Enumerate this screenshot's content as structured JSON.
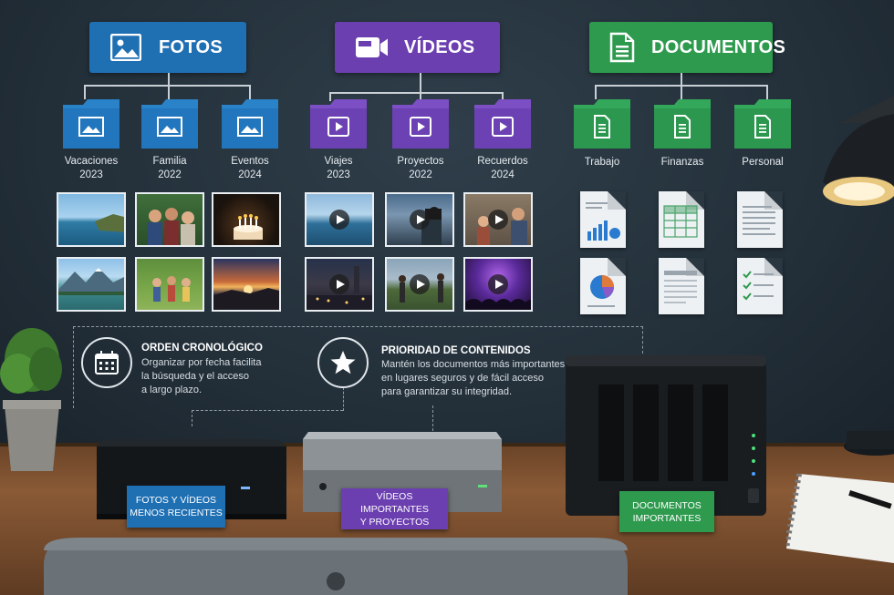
{
  "categories": {
    "fotos": {
      "label": "FOTOS",
      "color": "#1f6fb3",
      "icon": "image-icon"
    },
    "videos": {
      "label": "VÍDEOS",
      "color": "#6b3fb0",
      "icon": "video-camera-icon"
    },
    "documentos": {
      "label": "DOCUMENTOS",
      "color": "#2e9a4e",
      "icon": "document-icon"
    }
  },
  "folders": {
    "fotos": [
      {
        "line1": "Vacaciones",
        "line2": "2023"
      },
      {
        "line1": "Familia",
        "line2": "2022"
      },
      {
        "line1": "Eventos",
        "line2": "2024"
      }
    ],
    "videos": [
      {
        "line1": "Viajes",
        "line2": "2023"
      },
      {
        "line1": "Proyectos",
        "line2": "2022"
      },
      {
        "line1": "Recuerdos",
        "line2": "2024"
      }
    ],
    "documentos": [
      {
        "line1": "Trabajo",
        "line2": ""
      },
      {
        "line1": "Finanzas",
        "line2": ""
      },
      {
        "line1": "Personal",
        "line2": ""
      }
    ]
  },
  "info": {
    "cronologico": {
      "title": "ORDEN CRONOLÓGICO",
      "line1": "Organizar por fecha facilita",
      "line2": "la búsqueda y el acceso",
      "line3": "a largo plazo."
    },
    "prioridad": {
      "title": "PRIORIDAD DE CONTENIDOS",
      "line1": "Mantén los documentos más importantes",
      "line2": "en lugares seguros y de fácil acceso",
      "line3": "para garantizar su integridad."
    }
  },
  "devices": {
    "left": {
      "line1": "FOTOS Y VÍDEOS",
      "line2": "MENOS RECIENTES"
    },
    "middle": {
      "line1": "VÍDEOS IMPORTANTES",
      "line2": "Y PROYECTOS"
    },
    "right": {
      "line1": "DOCUMENTOS",
      "line2": "IMPORTANTES"
    }
  }
}
